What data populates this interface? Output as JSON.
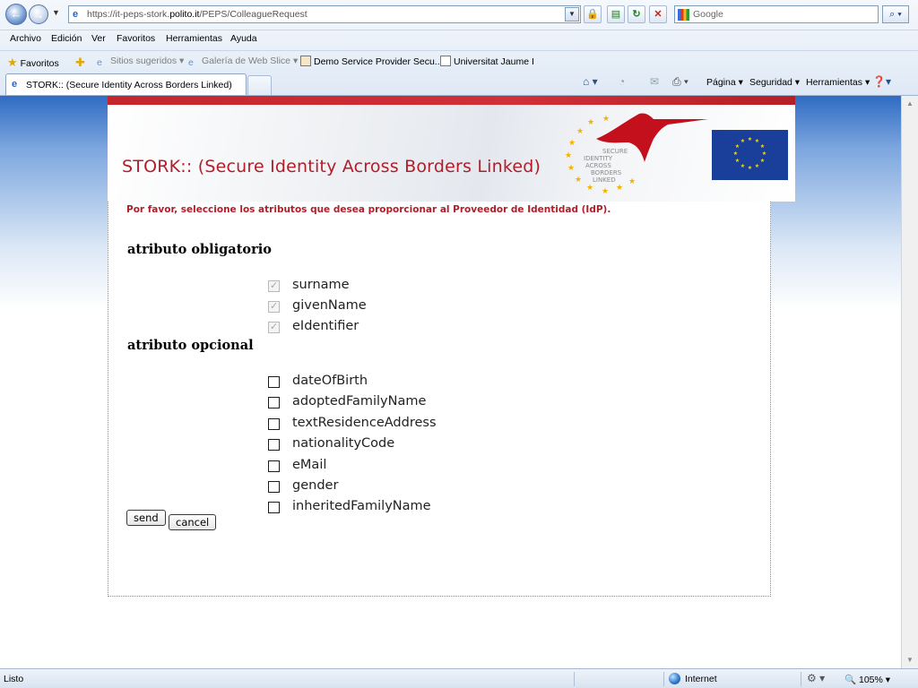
{
  "browser": {
    "url_prefix": "https://",
    "url_pre_domain": "it-peps-stork.",
    "url_domain": "polito.it",
    "url_path": "/PEPS/ColleagueRequest",
    "search_placeholder": "Google",
    "menu": [
      "Archivo",
      "Edición",
      "Ver",
      "Favoritos",
      "Herramientas",
      "Ayuda"
    ],
    "favorites_label": "Favoritos",
    "fav_links": [
      "Sitios sugeridos ▾",
      "Galería de Web Slice ▾",
      "Demo Service Provider Secu...",
      "Universitat Jaume I"
    ],
    "tab_title": "STORK:: (Secure Identity Across Borders Linked)",
    "commands": {
      "page": "Página ▾",
      "security": "Seguridad ▾",
      "tools": "Herramientas ▾"
    },
    "status": "Listo",
    "zone": "Internet",
    "zoom": "105%"
  },
  "banner": {
    "title": "STORK:: (Secure Identity Across Borders Linked)",
    "logo_text": [
      "SECURE",
      "IDENTITY",
      "ACROSS",
      "BORDERS",
      "LINKED"
    ]
  },
  "form": {
    "prompt": "Por favor, seleccione los atributos que desea proporcionar al Proveedor de Identidad (IdP).",
    "mandatory_heading": "atributo obligatorio",
    "mandatory_attrs": [
      "surname",
      "givenName",
      "eIdentifier"
    ],
    "optional_heading": "atributo opcional",
    "optional_attrs": [
      "dateOfBirth",
      "adoptedFamilyName",
      "textResidenceAddress",
      "nationalityCode",
      "eMail",
      "gender",
      "inheritedFamilyName"
    ],
    "send_label": "send",
    "cancel_label": "cancel"
  },
  "colors": {
    "accent_red": "#b21d2a",
    "ie_blue": "#2f6bc3",
    "eu_blue": "#1a3f9a",
    "eu_star": "#ffd400"
  }
}
